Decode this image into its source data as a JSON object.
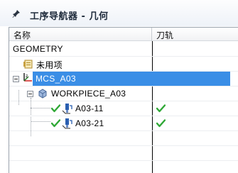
{
  "window": {
    "title": "工序导航器 - 几何",
    "title_icon": "pin-icon"
  },
  "columns": {
    "name": "名称",
    "toolpath": "刀轨"
  },
  "tree": {
    "root": "GEOMETRY",
    "unused": "未用项",
    "mcs": "MCS_A03",
    "workpiece": "WORKPIECE_A03",
    "ops": [
      {
        "name": "A03-11",
        "status": "complete-check-icon",
        "toolpath": "complete-check-icon"
      },
      {
        "name": "A03-21",
        "status": "complete-check-icon",
        "toolpath": "complete-check-icon"
      }
    ]
  },
  "colors": {
    "selection": "#3a8ee6",
    "check": "#2fa836"
  }
}
